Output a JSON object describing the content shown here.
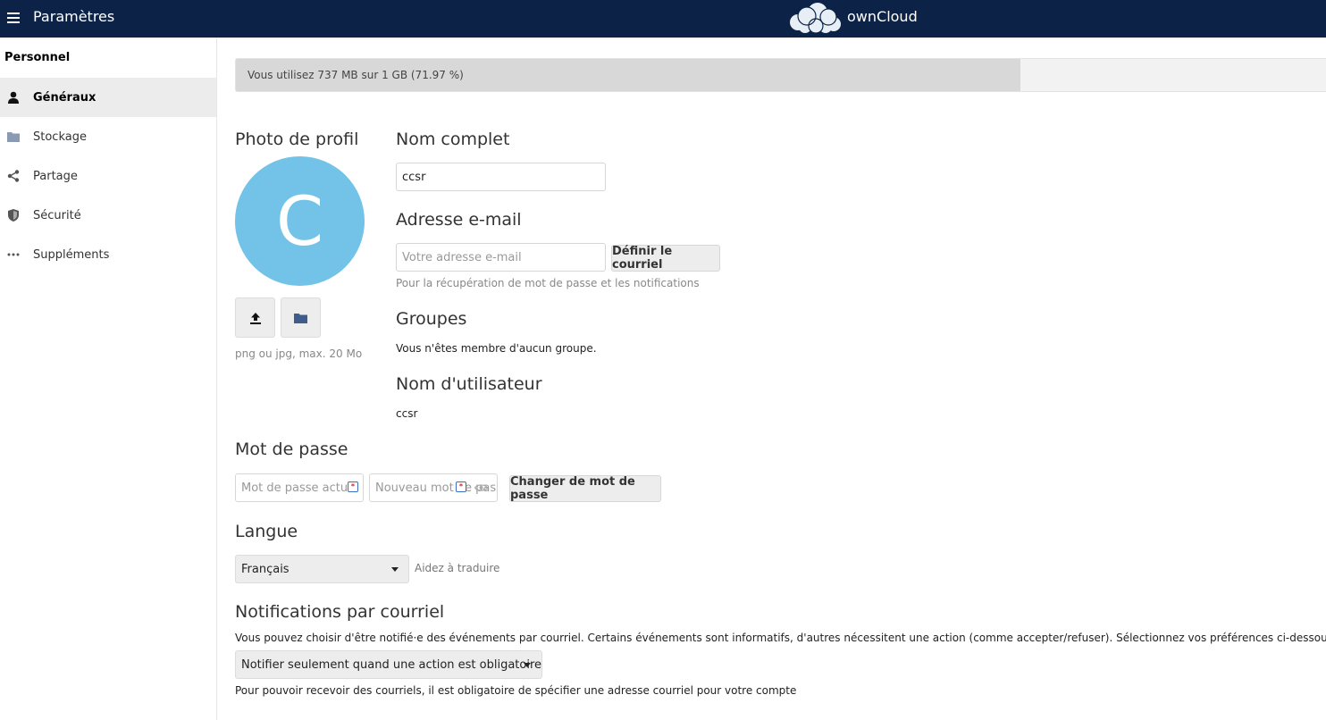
{
  "header": {
    "menu_icon": "hamburger-menu-icon",
    "title": "Paramètres",
    "brand": "ownCloud"
  },
  "sidebar": {
    "section": "Personnel",
    "items": [
      {
        "label": "Généraux",
        "icon": "user-icon",
        "active": true
      },
      {
        "label": "Stockage",
        "icon": "folder-icon",
        "active": false
      },
      {
        "label": "Partage",
        "icon": "share-icon",
        "active": false
      },
      {
        "label": "Sécurité",
        "icon": "shield-icon",
        "active": false
      },
      {
        "label": "Suppléments",
        "icon": "more-icon",
        "active": false
      }
    ]
  },
  "quota": {
    "text": "Vous utilisez 737 MB sur 1 GB (71.97 %)",
    "percent": 71.97
  },
  "profile": {
    "photo_title": "Photo de profil",
    "avatar_letter": "C",
    "avatar_color": "#72c3e7",
    "hint": "png ou jpg, max. 20 Mo"
  },
  "fullname": {
    "title": "Nom complet",
    "value": "ccsr"
  },
  "email": {
    "title": "Adresse e-mail",
    "placeholder": "Votre adresse e-mail",
    "button": "Définir le courriel",
    "hint": "Pour la récupération de mot de passe et les notifications"
  },
  "groups": {
    "title": "Groupes",
    "text": "Vous n'êtes membre d'aucun groupe."
  },
  "username": {
    "title": "Nom d'utilisateur",
    "value": "ccsr"
  },
  "password": {
    "title": "Mot de passe",
    "current_placeholder": "Mot de passe actuel",
    "new_placeholder": "Nouveau mot de passe",
    "button": "Changer de mot de passe"
  },
  "language": {
    "title": "Langue",
    "selected": "Français",
    "help_link": "Aidez à traduire"
  },
  "notifications": {
    "title": "Notifications par courriel",
    "description": "Vous pouvez choisir d'être notifié·e des événements par courriel. Certains événements sont informatifs, d'autres nécessitent une action (comme accepter/refuser). Sélectionnez vos préférences ci-dessous :",
    "selected": "Notifier seulement quand une action est obligatoire",
    "footer": "Pour pouvoir recevoir des courriels, il est obligatoire de spécifier une adresse courriel pour votre compte"
  },
  "colors": {
    "header_bg": "#0c2347",
    "accent": "#72c3e7"
  }
}
